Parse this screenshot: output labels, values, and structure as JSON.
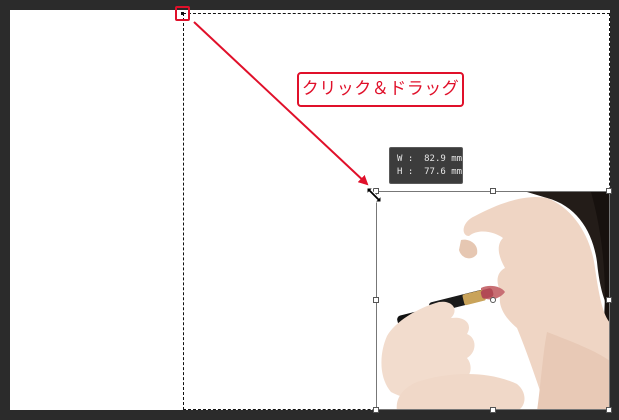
{
  "callout": {
    "text": "クリック＆ドラッグ"
  },
  "tooltip": {
    "width_label": "W :",
    "width_value": "82.9 mm",
    "height_label": "H :",
    "height_value": "77.6 mm"
  },
  "image": {
    "subject": "woman applying lipstick"
  },
  "icons": [
    "resize-diagonal-cursor-icon",
    "arrow-icon"
  ],
  "colors": {
    "accent": "#e0102a",
    "tooltip_bg": "#3c3c3c",
    "workspace_bg": "#2b2b2b"
  }
}
